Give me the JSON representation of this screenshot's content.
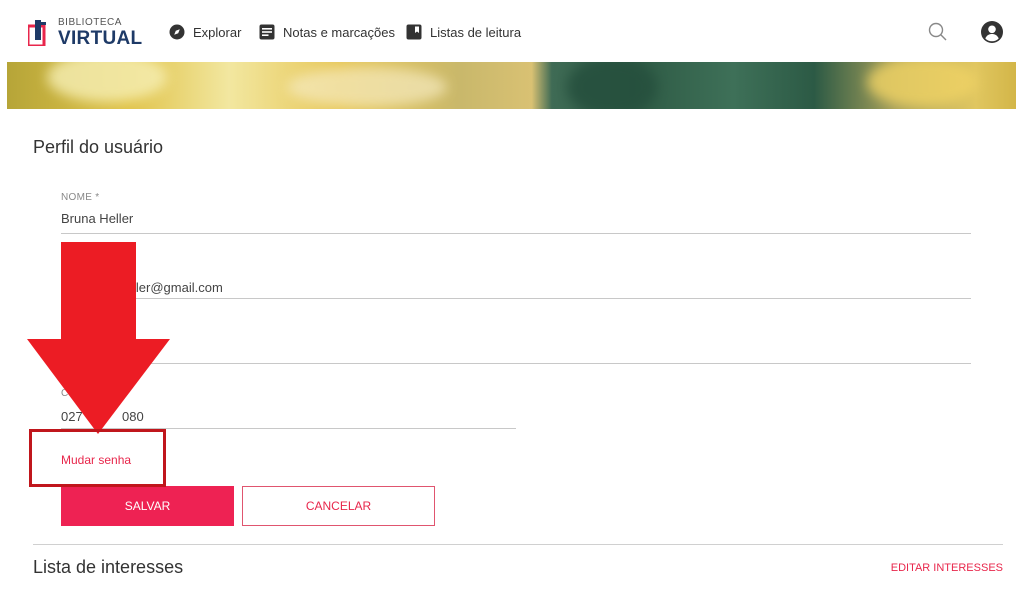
{
  "brand": {
    "line1": "BIBLIOTECA",
    "line2": "VIRTUAL",
    "accent": "#e8264b",
    "navy": "#1e3a67"
  },
  "nav": {
    "explorar": "Explorar",
    "notas": "Notas e marcações",
    "listas": "Listas de leitura"
  },
  "page": {
    "title": "Perfil do usuário"
  },
  "form": {
    "nome_label": "NOME *",
    "nome_value": "Bruna Heller",
    "email_value_visible": "ller@gmail.com",
    "phone_value_visible_a": "027",
    "phone_value_visible_b": "080",
    "change_password": "Mudar senha",
    "save": "SALVAR",
    "cancel": "CANCELAR"
  },
  "interests": {
    "title": "Lista de interesses",
    "edit": "EDITAR INTERESSES"
  },
  "icons": {
    "explorar": "compass-icon",
    "notas": "note-icon",
    "listas": "bookmark-icon",
    "search": "search-icon",
    "account": "account-icon"
  },
  "annotation": {
    "arrow_color": "#ec1c24",
    "highlight_color": "#c0161c"
  }
}
